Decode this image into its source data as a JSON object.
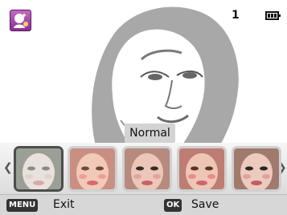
{
  "status": {
    "shot_count": "1"
  },
  "preview": {
    "level_label": "Normal"
  },
  "thumbnails": [
    {
      "skin": "#e9e2dc",
      "eyes": "#8a8a8a",
      "lips": "#d8aaa6",
      "cheeks": "#e2d2cc",
      "bg": "#9aa095"
    },
    {
      "skin": "#f2c9b9",
      "eyes": "#6b4a3a",
      "lips": "#d86b6e",
      "cheeks": "#ec9f96",
      "bg": "#c98f83"
    },
    {
      "skin": "#ecc7b9",
      "eyes": "#3a2a22",
      "lips": "#c7626a",
      "cheeks": "#e3a59a",
      "bg": "#b68a7c"
    },
    {
      "skin": "#efc5b6",
      "eyes": "#5a3424",
      "lips": "#c96670",
      "cheeks": "#e88e86",
      "bg": "#bd7d73"
    },
    {
      "skin": "#eccabd",
      "eyes": "#2e2420",
      "lips": "#c15c66",
      "cheeks": "#e0a399",
      "bg": "#9f7a6d"
    }
  ],
  "bottom_bar": {
    "menu_key": "MENU",
    "exit_label": "Exit",
    "ok_key": "OK",
    "save_label": "Save"
  }
}
